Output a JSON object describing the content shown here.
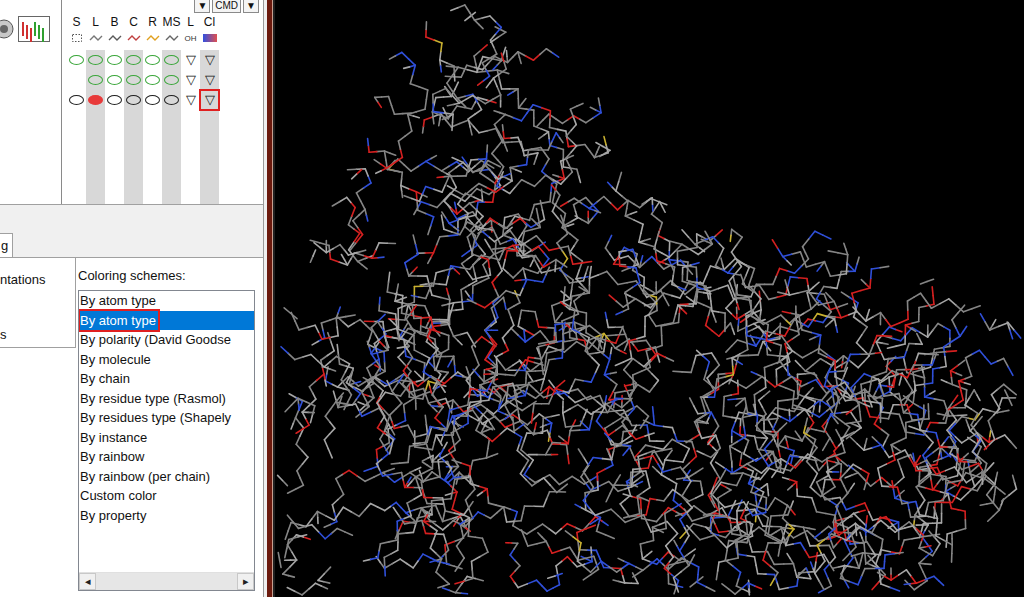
{
  "toolbar": {
    "controls": [
      "▼",
      "CMD",
      "▼"
    ]
  },
  "grid": {
    "columns": [
      {
        "label": "S",
        "sub": ""
      },
      {
        "label": "L",
        "sub": ""
      },
      {
        "label": "B",
        "sub": ""
      },
      {
        "label": "C",
        "sub": ""
      },
      {
        "label": "R",
        "sub": ""
      },
      {
        "label": "MS",
        "sub": ""
      },
      {
        "label": "L",
        "sub": "OH"
      },
      {
        "label": "Cl",
        "sub": ""
      }
    ],
    "rows": [
      {
        "cells": [
          {
            "kind": "oval",
            "color": "#3aa63a",
            "filled": false
          },
          {
            "kind": "oval",
            "color": "#3aa63a",
            "filled": false
          },
          {
            "kind": "oval",
            "color": "#3aa63a",
            "filled": false
          },
          {
            "kind": "oval",
            "color": "#3aa63a",
            "filled": false
          },
          {
            "kind": "oval",
            "color": "#3aa63a",
            "filled": false
          },
          {
            "kind": "oval",
            "color": "#3aa63a",
            "filled": false
          },
          {
            "kind": "triangle",
            "glyph": "▽",
            "annotated": false
          },
          {
            "kind": "triangle",
            "glyph": "▽",
            "annotated": false
          }
        ]
      },
      {
        "cells": [
          {
            "kind": "blank"
          },
          {
            "kind": "oval",
            "color": "#3aa63a",
            "filled": false
          },
          {
            "kind": "oval",
            "color": "#3aa63a",
            "filled": false
          },
          {
            "kind": "oval",
            "color": "#3aa63a",
            "filled": false
          },
          {
            "kind": "oval",
            "color": "#3aa63a",
            "filled": false
          },
          {
            "kind": "oval",
            "color": "#3aa63a",
            "filled": false
          },
          {
            "kind": "triangle",
            "glyph": "▽",
            "annotated": false
          },
          {
            "kind": "triangle",
            "glyph": "▽",
            "annotated": false
          }
        ]
      },
      {
        "cells": [
          {
            "kind": "oval",
            "color": "#202020",
            "filled": false
          },
          {
            "kind": "oval",
            "color": "#e83a3a",
            "filled": true
          },
          {
            "kind": "oval",
            "color": "#202020",
            "filled": false
          },
          {
            "kind": "oval",
            "color": "#202020",
            "filled": false
          },
          {
            "kind": "oval",
            "color": "#202020",
            "filled": false
          },
          {
            "kind": "oval",
            "color": "#202020",
            "filled": false
          },
          {
            "kind": "triangle",
            "glyph": "▽",
            "annotated": false
          },
          {
            "kind": "triangle",
            "glyph": "▽",
            "annotated": true
          }
        ]
      }
    ]
  },
  "tabs": [
    {
      "label": "g",
      "selected": true
    }
  ],
  "sidebar": {
    "items": [
      "ntations",
      "s"
    ]
  },
  "coloring": {
    "label": "Coloring schemes:",
    "items": [
      {
        "label": "By atom type",
        "selected": false,
        "annotated": false
      },
      {
        "label": "By atom type",
        "selected": true,
        "annotated": true
      },
      {
        "label": "By polarity (David Goodse",
        "selected": false,
        "annotated": false
      },
      {
        "label": "By molecule",
        "selected": false,
        "annotated": false
      },
      {
        "label": "By chain",
        "selected": false,
        "annotated": false
      },
      {
        "label": "By residue type (Rasmol)",
        "selected": false,
        "annotated": false
      },
      {
        "label": "By residues type (Shapely",
        "selected": false,
        "annotated": false
      },
      {
        "label": "By instance",
        "selected": false,
        "annotated": false
      },
      {
        "label": "By rainbow",
        "selected": false,
        "annotated": false
      },
      {
        "label": "By rainbow (per chain)",
        "selected": false,
        "annotated": false
      },
      {
        "label": "Custom color",
        "selected": false,
        "annotated": false
      },
      {
        "label": "By property",
        "selected": false,
        "annotated": false
      }
    ],
    "scrollbar": {
      "left": "◂",
      "right": "▸"
    }
  }
}
